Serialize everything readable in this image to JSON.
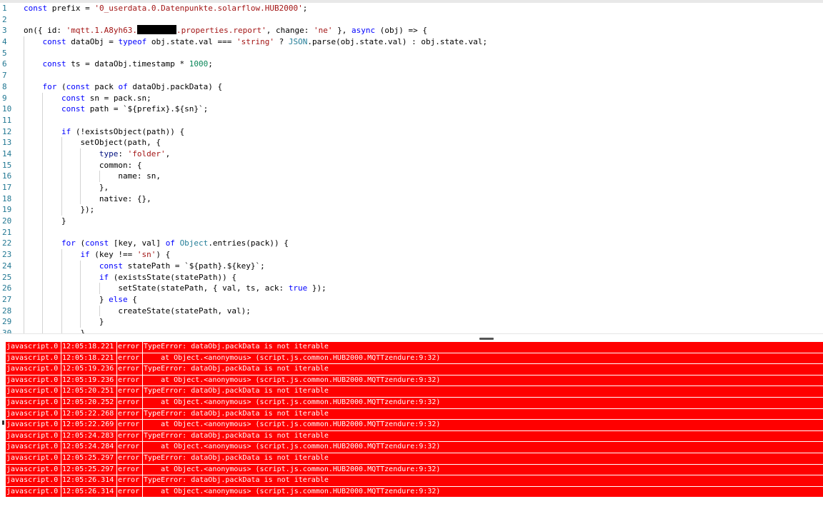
{
  "editor": {
    "lines": [
      {
        "n": "1",
        "indent": 0,
        "tokens": [
          [
            "kw",
            "const"
          ],
          [
            "plain",
            " prefix = "
          ],
          [
            "str",
            "'0_userdata.0.Datenpunkte.solarflow.HUB2000'"
          ],
          [
            "plain",
            ";"
          ]
        ]
      },
      {
        "n": "2",
        "indent": 0,
        "tokens": []
      },
      {
        "n": "3",
        "indent": 0,
        "tokens": [
          [
            "plain",
            "on({ id: "
          ],
          [
            "str",
            "'mqtt.1.A8yh63."
          ],
          [
            "redact",
            ""
          ],
          [
            "str",
            ".properties.report'"
          ],
          [
            "plain",
            ", change: "
          ],
          [
            "str",
            "'ne'"
          ],
          [
            "plain",
            " }, "
          ],
          [
            "kw",
            "async"
          ],
          [
            "plain",
            " (obj) => {"
          ]
        ]
      },
      {
        "n": "4",
        "indent": 1,
        "tokens": [
          [
            "kw",
            "const"
          ],
          [
            "plain",
            " dataObj = "
          ],
          [
            "kw",
            "typeof"
          ],
          [
            "plain",
            " obj.state.val === "
          ],
          [
            "str",
            "'string'"
          ],
          [
            "plain",
            " ? "
          ],
          [
            "type",
            "JSON"
          ],
          [
            "plain",
            ".parse(obj.state.val) : obj.state.val;"
          ]
        ]
      },
      {
        "n": "5",
        "indent": 1,
        "tokens": []
      },
      {
        "n": "6",
        "indent": 1,
        "tokens": [
          [
            "kw",
            "const"
          ],
          [
            "plain",
            " ts = dataObj.timestamp * "
          ],
          [
            "num",
            "1000"
          ],
          [
            "plain",
            ";"
          ]
        ]
      },
      {
        "n": "7",
        "indent": 1,
        "tokens": []
      },
      {
        "n": "8",
        "indent": 1,
        "tokens": [
          [
            "kw",
            "for"
          ],
          [
            "plain",
            " ("
          ],
          [
            "kw",
            "const"
          ],
          [
            "plain",
            " pack "
          ],
          [
            "kw",
            "of"
          ],
          [
            "plain",
            " dataObj.packData) {"
          ]
        ]
      },
      {
        "n": "9",
        "indent": 2,
        "tokens": [
          [
            "kw",
            "const"
          ],
          [
            "plain",
            " sn = pack.sn;"
          ]
        ]
      },
      {
        "n": "10",
        "indent": 2,
        "tokens": [
          [
            "kw",
            "const"
          ],
          [
            "plain",
            " path = `${prefix}.${sn}`;"
          ]
        ]
      },
      {
        "n": "11",
        "indent": 2,
        "tokens": []
      },
      {
        "n": "12",
        "indent": 2,
        "tokens": [
          [
            "kw",
            "if"
          ],
          [
            "plain",
            " (!existsObject(path)) {"
          ]
        ]
      },
      {
        "n": "13",
        "indent": 3,
        "tokens": [
          [
            "plain",
            "setObject(path, {"
          ]
        ]
      },
      {
        "n": "14",
        "indent": 4,
        "tokens": [
          [
            "prop",
            "type"
          ],
          [
            "plain",
            ": "
          ],
          [
            "str",
            "'folder'"
          ],
          [
            "plain",
            ","
          ]
        ]
      },
      {
        "n": "15",
        "indent": 4,
        "tokens": [
          [
            "plain",
            "common: {"
          ]
        ]
      },
      {
        "n": "16",
        "indent": 5,
        "tokens": [
          [
            "plain",
            "name: sn,"
          ]
        ]
      },
      {
        "n": "17",
        "indent": 4,
        "tokens": [
          [
            "plain",
            "},"
          ]
        ]
      },
      {
        "n": "18",
        "indent": 4,
        "tokens": [
          [
            "plain",
            "native: {},"
          ]
        ]
      },
      {
        "n": "19",
        "indent": 3,
        "tokens": [
          [
            "plain",
            "});"
          ]
        ]
      },
      {
        "n": "20",
        "indent": 2,
        "tokens": [
          [
            "plain",
            "}"
          ]
        ]
      },
      {
        "n": "21",
        "indent": 2,
        "tokens": []
      },
      {
        "n": "22",
        "indent": 2,
        "tokens": [
          [
            "kw",
            "for"
          ],
          [
            "plain",
            " ("
          ],
          [
            "kw",
            "const"
          ],
          [
            "plain",
            " [key, val] "
          ],
          [
            "kw",
            "of"
          ],
          [
            "plain",
            " "
          ],
          [
            "type",
            "Object"
          ],
          [
            "plain",
            ".entries(pack)) {"
          ]
        ]
      },
      {
        "n": "23",
        "indent": 3,
        "tokens": [
          [
            "kw",
            "if"
          ],
          [
            "plain",
            " (key !== "
          ],
          [
            "str",
            "'sn'"
          ],
          [
            "plain",
            ") {"
          ]
        ]
      },
      {
        "n": "24",
        "indent": 4,
        "tokens": [
          [
            "kw",
            "const"
          ],
          [
            "plain",
            " statePath = `${path}.${key}`;"
          ]
        ]
      },
      {
        "n": "25",
        "indent": 4,
        "tokens": [
          [
            "kw",
            "if"
          ],
          [
            "plain",
            " (existsState(statePath)) {"
          ]
        ]
      },
      {
        "n": "26",
        "indent": 5,
        "tokens": [
          [
            "plain",
            "setState(statePath, { val, ts, ack: "
          ],
          [
            "kw",
            "true"
          ],
          [
            "plain",
            " });"
          ]
        ]
      },
      {
        "n": "27",
        "indent": 4,
        "tokens": [
          [
            "plain",
            "} "
          ],
          [
            "kw",
            "else"
          ],
          [
            "plain",
            " {"
          ]
        ]
      },
      {
        "n": "28",
        "indent": 5,
        "tokens": [
          [
            "plain",
            "createState(statePath, val);"
          ]
        ]
      },
      {
        "n": "29",
        "indent": 4,
        "tokens": [
          [
            "plain",
            "}"
          ]
        ]
      },
      {
        "n": "30",
        "indent": 3,
        "tokens": [
          [
            "plain",
            "}"
          ]
        ]
      }
    ]
  },
  "log": {
    "rows": [
      {
        "source": "javascript.0",
        "time": "12:05:18.221",
        "level": "error",
        "message": "TypeError: dataObj.packData is not iterable"
      },
      {
        "source": "javascript.0",
        "time": "12:05:18.221",
        "level": "error",
        "message": "    at Object.<anonymous> (script.js.common.HUB2000.MQTTzendure:9:32)"
      },
      {
        "source": "javascript.0",
        "time": "12:05:19.236",
        "level": "error",
        "message": "TypeError: dataObj.packData is not iterable"
      },
      {
        "source": "javascript.0",
        "time": "12:05:19.236",
        "level": "error",
        "message": "    at Object.<anonymous> (script.js.common.HUB2000.MQTTzendure:9:32)"
      },
      {
        "source": "javascript.0",
        "time": "12:05:20.251",
        "level": "error",
        "message": "TypeError: dataObj.packData is not iterable"
      },
      {
        "source": "javascript.0",
        "time": "12:05:20.252",
        "level": "error",
        "message": "    at Object.<anonymous> (script.js.common.HUB2000.MQTTzendure:9:32)"
      },
      {
        "source": "javascript.0",
        "time": "12:05:22.268",
        "level": "error",
        "message": "TypeError: dataObj.packData is not iterable"
      },
      {
        "source": "javascript.0",
        "time": "12:05:22.269",
        "level": "error",
        "message": "    at Object.<anonymous> (script.js.common.HUB2000.MQTTzendure:9:32)"
      },
      {
        "source": "javascript.0",
        "time": "12:05:24.283",
        "level": "error",
        "message": "TypeError: dataObj.packData is not iterable"
      },
      {
        "source": "javascript.0",
        "time": "12:05:24.284",
        "level": "error",
        "message": "    at Object.<anonymous> (script.js.common.HUB2000.MQTTzendure:9:32)"
      },
      {
        "source": "javascript.0",
        "time": "12:05:25.297",
        "level": "error",
        "message": "TypeError: dataObj.packData is not iterable"
      },
      {
        "source": "javascript.0",
        "time": "12:05:25.297",
        "level": "error",
        "message": "    at Object.<anonymous> (script.js.common.HUB2000.MQTTzendure:9:32)"
      },
      {
        "source": "javascript.0",
        "time": "12:05:26.314",
        "level": "error",
        "message": "TypeError: dataObj.packData is not iterable"
      },
      {
        "source": "javascript.0",
        "time": "12:05:26.314",
        "level": "error",
        "message": "    at Object.<anonymous> (script.js.common.HUB2000.MQTTzendure:9:32)"
      }
    ]
  }
}
